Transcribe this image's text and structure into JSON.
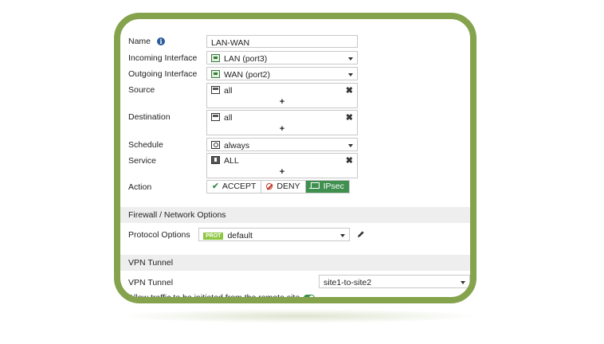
{
  "form": {
    "name_label": "Name",
    "name_value": "LAN-WAN",
    "incoming_label": "Incoming Interface",
    "incoming_value": "LAN (port3)",
    "outgoing_label": "Outgoing Interface",
    "outgoing_value": "WAN (port2)",
    "source_label": "Source",
    "source_value": "all",
    "destination_label": "Destination",
    "destination_value": "all",
    "schedule_label": "Schedule",
    "schedule_value": "always",
    "service_label": "Service",
    "service_value": "ALL",
    "action_label": "Action",
    "actions": [
      {
        "label": "ACCEPT",
        "active": false
      },
      {
        "label": "DENY",
        "active": false
      },
      {
        "label": "IPsec",
        "active": true
      }
    ],
    "remove_glyph": "✖",
    "add_glyph": "+"
  },
  "firewall_section": {
    "title": "Firewall / Network Options",
    "protocol_label": "Protocol Options",
    "protocol_badge": "PROT",
    "protocol_value": "default"
  },
  "vpn_section": {
    "title": "VPN Tunnel",
    "tunnel_label": "VPN Tunnel",
    "tunnel_value": "site1-to-site2",
    "allow_remote_label": "Allow traffic to be initiated from the remote site",
    "allow_remote_enabled": true
  },
  "colors": {
    "frame": "#84a34c",
    "accent": "#3f8f4f",
    "deny": "#c0392b",
    "info": "#2a5a9a"
  }
}
